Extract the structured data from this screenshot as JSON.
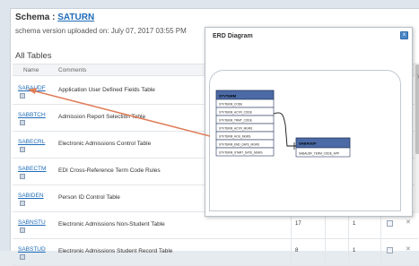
{
  "header": {
    "schema_label": "Schema : ",
    "schema_name": "SATURN",
    "version_text": "schema version uploaded on: July 07, 2017 03:55 PM"
  },
  "tables_title": "All Tables",
  "columns": {
    "name": "Name",
    "comments": "Comments"
  },
  "rows": [
    {
      "name": "SABAUDF",
      "comment": "Application User Defined Fields Table",
      "num1": "",
      "num2": ""
    },
    {
      "name": "SABBTCH",
      "comment": "Admission Report Selection Table",
      "num1": "",
      "num2": ""
    },
    {
      "name": "SABECRL",
      "comment": "Electronic Admissions Control Table",
      "num1": "",
      "num2": ""
    },
    {
      "name": "SABECTM",
      "comment": "EDI Cross-Reference Term Code Rules",
      "num1": "",
      "num2": ""
    },
    {
      "name": "SABIDEN",
      "comment": "Person ID Control Table",
      "num1": "",
      "num2": ""
    },
    {
      "name": "SABNSTU",
      "comment": "Electronic Admissions Non-Student Table",
      "num1": "17",
      "num2": "1"
    },
    {
      "name": "SABSTUD",
      "comment": "Electronic Admissions Student Record Table",
      "num1": "8",
      "num2": "1"
    }
  ],
  "modal": {
    "title": "ERD Diagram",
    "close_label": "x",
    "table1": {
      "name": "STVTERM",
      "fields": [
        "STVTERM_CODE",
        "STVTERM_ACYR_CODE",
        "STVTERM_TRMT_CODE",
        "STVTERM_ACYR_MGRS",
        "STVTERM_HOU_MGRS",
        "STVTERM_END_DATE_MGRS",
        "STVTERM_START_DATE_MGRS"
      ]
    },
    "table2": {
      "name": "SABAUDF",
      "fields": [
        "SABAUDF_TERM_CODE_APP"
      ]
    }
  },
  "partial_header_text": "y",
  "colors": {
    "link": "#1e6bb8",
    "table_header": "#4b6aa6",
    "close_button": "#4a86c8",
    "arrow": "#e07f5b"
  }
}
